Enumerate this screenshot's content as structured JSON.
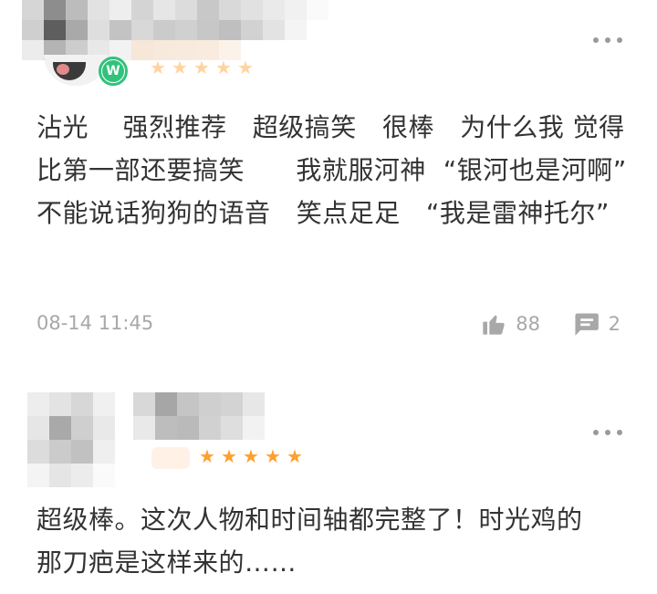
{
  "reviews": [
    {
      "stars": 5,
      "avatar_badge": "W",
      "text": "沾光    强烈推荐   超级搞笑   很棒   为什么我 觉得比第一部还要搞笑      我就服河神  “银河也是河啊”      不能说话狗狗的语音   笑点足足   “我是雷神托尔”",
      "time": "08-14 11:45",
      "likes": "88",
      "comments": "2"
    },
    {
      "stars": 5,
      "text": "超级棒。这次人物和时间轴都完整了！时光鸡的那刀疤是这样来的……"
    }
  ],
  "colors": {
    "star": "#ff9f2e",
    "verified": "#31c27c",
    "meta": "#a8a8a8",
    "text": "#333333"
  },
  "icons": {
    "more": "more-dots-icon",
    "like": "thumbs-up-icon",
    "comment": "comment-bubble-icon",
    "star": "star-icon"
  }
}
